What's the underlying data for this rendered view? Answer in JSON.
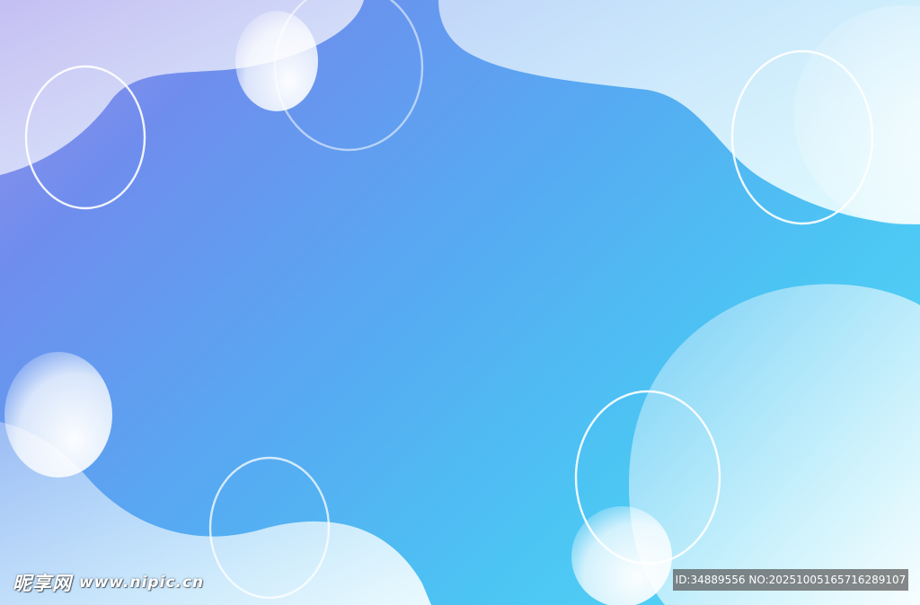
{
  "watermark": {
    "brand": "昵享网",
    "site": "www.nipic.cn",
    "id_text": "ID:34889556 NO:20251005165716289107"
  },
  "colors": {
    "top_left": "#9a93ea",
    "center": "#57a9f2",
    "edges": "#56dcf7",
    "highlight": "#ffffff"
  }
}
